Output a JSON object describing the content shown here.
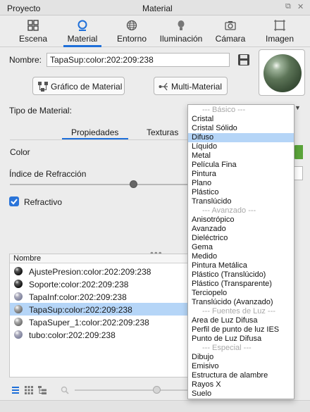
{
  "window": {
    "project_title": "Proyecto",
    "material_title": "Material"
  },
  "tabs": [
    {
      "label": "Escena"
    },
    {
      "label": "Material"
    },
    {
      "label": "Entorno"
    },
    {
      "label": "Iluminación"
    },
    {
      "label": "Cámara"
    },
    {
      "label": "Imagen"
    }
  ],
  "form": {
    "name_label": "Nombre:",
    "name_value": "TapaSup:color:202:209:238",
    "graph_button": "Gráfico de Material",
    "multi_button": "Multi-Material",
    "type_label": "Tipo de Material:"
  },
  "subtabs": [
    "Propiedades",
    "Texturas"
  ],
  "properties": {
    "color_label": "Color",
    "ior_label": "Índice de Refracción",
    "refractive_label": "Refractivo",
    "refractive_checked": true
  },
  "tree": {
    "column_header": "Nombre",
    "items": [
      {
        "label": "AjustePresion:color:202:209:238",
        "ball": "black"
      },
      {
        "label": "Soporte:color:202:209:238",
        "ball": "black"
      },
      {
        "label": "TapaInf:color:202:209:238",
        "ball": "blue"
      },
      {
        "label": "TapaSup:color:202:209:238",
        "ball": "grey"
      },
      {
        "label": "TapaSuper_1:color:202:209:238",
        "ball": "grey"
      },
      {
        "label": "tubo:color:202:209:238",
        "ball": "blue"
      }
    ],
    "selected_index": 3
  },
  "dropdown": {
    "options": [
      {
        "label": "--- Básico ---",
        "header": true
      },
      {
        "label": "Cristal"
      },
      {
        "label": "Cristal Sólido"
      },
      {
        "label": "Difuso",
        "highlighted": true
      },
      {
        "label": "Líquido"
      },
      {
        "label": "Metal"
      },
      {
        "label": "Película Fina"
      },
      {
        "label": "Pintura"
      },
      {
        "label": "Plano"
      },
      {
        "label": "Plástico"
      },
      {
        "label": "Translúcido"
      },
      {
        "label": "--- Avanzado ---",
        "header": true
      },
      {
        "label": "Anisotrópico"
      },
      {
        "label": "Avanzado"
      },
      {
        "label": "Dieléctrico"
      },
      {
        "label": "Gema"
      },
      {
        "label": "Medido"
      },
      {
        "label": "Pintura Metálica"
      },
      {
        "label": "Plástico (Translúcido)"
      },
      {
        "label": "Plástico (Transparente)"
      },
      {
        "label": "Terciopelo"
      },
      {
        "label": "Translúcido (Avanzado)"
      },
      {
        "label": "--- Fuentes de Luz ---",
        "header": true
      },
      {
        "label": "Area de Luz Difusa"
      },
      {
        "label": "Perfil de punto de luz IES"
      },
      {
        "label": "Punto de Luz Difusa"
      },
      {
        "label": "--- Especial ---",
        "header": true
      },
      {
        "label": "Dibujo"
      },
      {
        "label": "Emisivo"
      },
      {
        "label": "Estructura de alambre"
      },
      {
        "label": "Rayos X"
      },
      {
        "label": "Suelo"
      }
    ]
  },
  "colors": {
    "accent": "#1e6fd9",
    "selection": "#b5d5f7",
    "material_color": "#5aa43a"
  }
}
